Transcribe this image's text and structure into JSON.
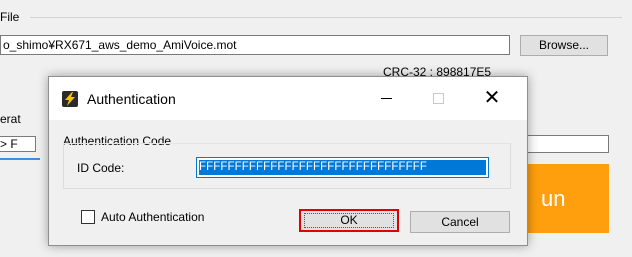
{
  "background": {
    "file_section_label": "File",
    "file_path": "o_shimo¥RX671_aws_demo_AmiVoice.mot",
    "browse_label": "Browse...",
    "crc_text": "CRC-32 : 898817E5",
    "operation_label": "erat",
    "operation_field_text": "> F",
    "run_label": "un",
    "run_color": "#ff9f0d"
  },
  "dialog": {
    "title": "Authentication",
    "app_icon": "lightning-app-icon",
    "group_label": "Authentication Code",
    "id_code_label": "ID Code:",
    "id_code_value": "FFFFFFFFFFFFFFFFFFFFFFFFFFFFFFFF",
    "auto_auth_label": "Auto Authentication",
    "auto_auth_checked": false,
    "ok_label": "OK",
    "cancel_label": "Cancel",
    "highlight_color": "#e00000",
    "selection_color": "#0078d7"
  }
}
